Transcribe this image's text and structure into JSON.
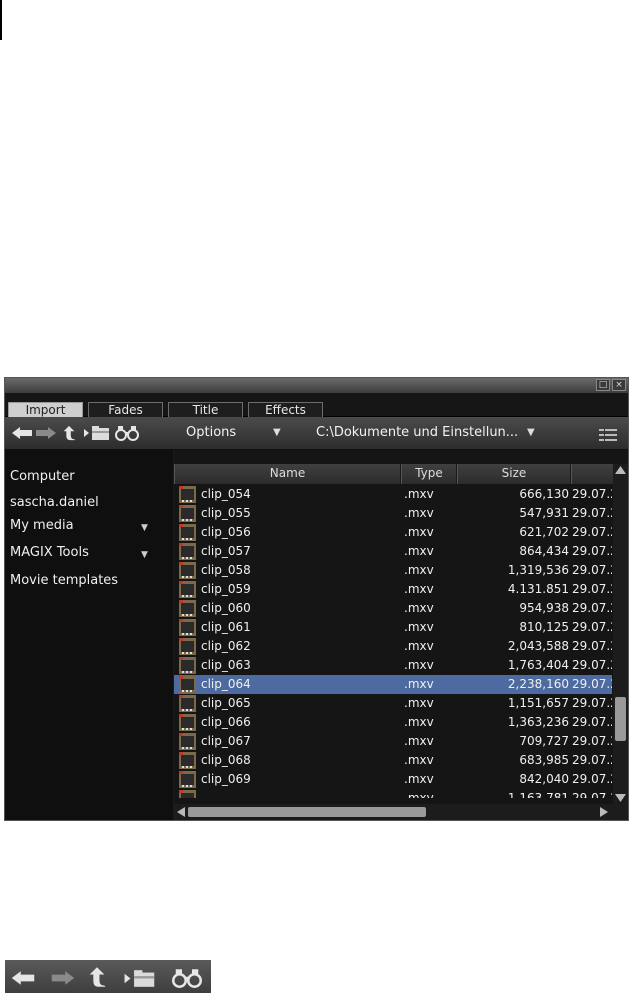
{
  "window": {
    "restore_glyph": "□",
    "close_glyph": "×"
  },
  "tabs": [
    {
      "label": "Import",
      "active": true
    },
    {
      "label": "Fades",
      "active": false
    },
    {
      "label": "Title",
      "active": false
    },
    {
      "label": "Effects",
      "active": false
    }
  ],
  "toolbar": {
    "icons": [
      "back-arrow-icon",
      "forward-arrow-icon",
      "up-folder-icon",
      "new-folder-icon",
      "binoculars-icon"
    ],
    "options_label": "Options",
    "path": "C:\\Dokumente und Einstellun...",
    "view_icon": "list-view-icon"
  },
  "sidebar": {
    "items": [
      {
        "label": "Computer",
        "has_dropdown": false
      },
      {
        "label": "sascha.daniel",
        "has_dropdown": false
      },
      {
        "label": "My media",
        "has_dropdown": true
      },
      {
        "label": "MAGIX Tools",
        "has_dropdown": true
      },
      {
        "label": "Movie templates",
        "has_dropdown": false
      }
    ]
  },
  "columns": {
    "name": "Name",
    "type": "Type",
    "size": "Size"
  },
  "files": [
    {
      "name": "clip_054",
      "type": ".mxv",
      "size": "666,130",
      "date": "29.07.2"
    },
    {
      "name": "clip_055",
      "type": ".mxv",
      "size": "547,931",
      "date": "29.07.2"
    },
    {
      "name": "clip_056",
      "type": ".mxv",
      "size": "621,702",
      "date": "29.07.2"
    },
    {
      "name": "clip_057",
      "type": ".mxv",
      "size": "864,434",
      "date": "29.07.2"
    },
    {
      "name": "clip_058",
      "type": ".mxv",
      "size": "1,319,536",
      "date": "29.07.2"
    },
    {
      "name": "clip_059",
      "type": ".mxv",
      "size": "4.131.851",
      "date": "29.07.2"
    },
    {
      "name": "clip_060",
      "type": ".mxv",
      "size": "954,938",
      "date": "29.07.2"
    },
    {
      "name": "clip_061",
      "type": ".mxv",
      "size": "810,125",
      "date": "29.07.2"
    },
    {
      "name": "clip_062",
      "type": ".mxv",
      "size": "2,043,588",
      "date": "29.07.2"
    },
    {
      "name": "clip_063",
      "type": ".mxv",
      "size": "1,763,404",
      "date": "29.07.2"
    },
    {
      "name": "clip_064",
      "type": ".mxv",
      "size": "2,238,160",
      "date": "29.07.2",
      "selected": true
    },
    {
      "name": "clip_065",
      "type": ".mxv",
      "size": "1,151,657",
      "date": "29.07.2"
    },
    {
      "name": "clip_066",
      "type": ".mxv",
      "size": "1,363,236",
      "date": "29.07.2"
    },
    {
      "name": "clip_067",
      "type": ".mxv",
      "size": "709,727",
      "date": "29.07.2"
    },
    {
      "name": "clip_068",
      "type": ".mxv",
      "size": "683,985",
      "date": "29.07.2"
    },
    {
      "name": "clip_069",
      "type": ".mxv",
      "size": "842,040",
      "date": "29.07.2"
    },
    {
      "name": "",
      "type": ".mxv",
      "size": "1,163,781",
      "date": "29.07.2"
    }
  ],
  "scroll": {
    "vertical_position": 0.75,
    "horizontal_fraction_visible": 0.55
  },
  "colors": {
    "selection": "#4d6ba0",
    "panel_bg": "#151515",
    "sidebar_bg": "#0f0f0f"
  },
  "icon_strip": [
    "back-arrow-icon",
    "forward-arrow-icon",
    "up-folder-icon",
    "new-folder-icon",
    "binoculars-icon"
  ]
}
